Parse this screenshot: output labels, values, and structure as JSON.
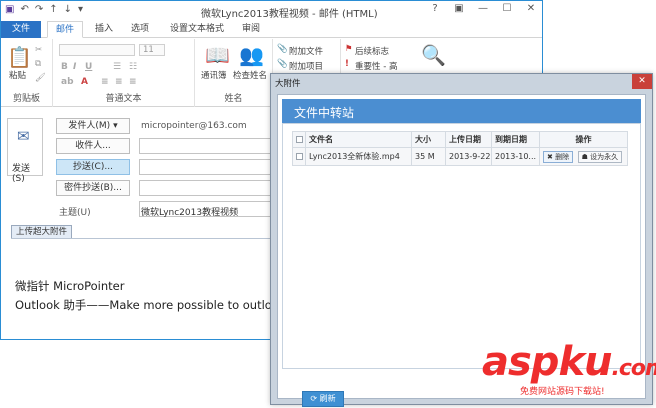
{
  "outlook": {
    "title": "微软Lync2013教程视频 - 邮件 (HTML)",
    "window_buttons": [
      "?",
      "▣",
      "—",
      "☐",
      "✕"
    ],
    "tabs": [
      "文件",
      "邮件",
      "插入",
      "选项",
      "设置文本格式",
      "审阅"
    ],
    "ribbon": {
      "clipboard": {
        "paste": "粘贴",
        "label": "剪贴板"
      },
      "basic_text": {
        "font_size": "11",
        "label": "普通文本"
      },
      "names": {
        "address_book": "通讯簿",
        "check_names": "检查姓名",
        "label": "姓名"
      },
      "include": {
        "attach_file": "附加文件",
        "attach_item": "附加项目"
      },
      "tags": {
        "follow_up": "后续标志",
        "importance_high": "重要性 - 高"
      }
    },
    "header": {
      "send": "发送(S)",
      "from_button": "发件人(M)",
      "from_value": "micropointer@163.com",
      "to_button": "收件人...",
      "cc_button": "抄送(C)...",
      "bcc_button": "密件抄送(B)...",
      "subject_label": "主题(U)",
      "subject_value": "微软Lync2013教程视频"
    },
    "attach_tab": "上传超大附件",
    "body": {
      "line1": "微指针 MicroPointer",
      "line2": "Outlook 助手——Make more possible to outlook"
    }
  },
  "dialog": {
    "title": "大附件",
    "close": "✕",
    "panel_title": "文件中转站",
    "columns": [
      "文件名",
      "大小",
      "上传日期",
      "到期日期",
      "操作"
    ],
    "rows": [
      {
        "filename": "Lync2013全新体验.mp4",
        "size": "35 M",
        "upload_date": "2013-9-22",
        "expire_date": "2013-10...",
        "delete": "删除",
        "make_permanent": "设为永久"
      }
    ],
    "refresh": "刷新"
  },
  "watermark": {
    "main": "asp",
    "ku": "ku",
    "tld": ".com",
    "sub": "免费网站源码下载站!"
  }
}
